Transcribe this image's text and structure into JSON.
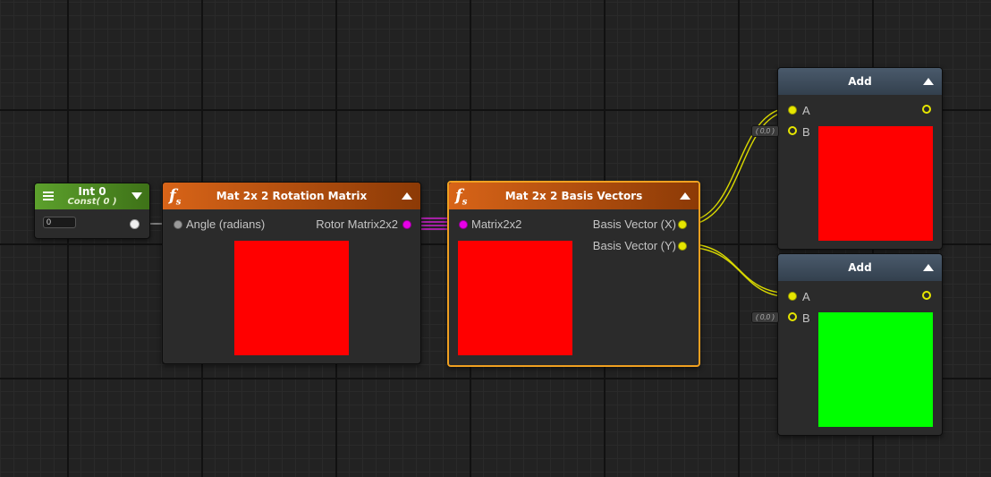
{
  "nodes": {
    "int_node": {
      "title": "Int 0",
      "subtitle": "Const( 0 )",
      "value": "0",
      "header_color": "#5ca02c"
    },
    "rotation_node": {
      "title": "Mat 2x 2 Rotation Matrix",
      "icon": "fs-function-icon",
      "input_label": "Angle (radians)",
      "output_label": "Rotor Matrix2x2",
      "preview_color": "#ff0000",
      "header_color": "#d86418"
    },
    "basis_node": {
      "title": "Mat 2x 2 Basis Vectors",
      "icon": "fs-function-icon",
      "input_label": "Matrix2x2",
      "output_x_label": "Basis Vector (X)",
      "output_y_label": "Basis Vector (Y)",
      "preview_color": "#ff0000",
      "selected": true,
      "selection_color": "#f0a020"
    },
    "add_node_1": {
      "title": "Add",
      "input_a": "A",
      "input_b": "B",
      "default_b": "( 0,0 )",
      "preview_color": "#ff0000"
    },
    "add_node_2": {
      "title": "Add",
      "input_a": "A",
      "input_b": "B",
      "default_b": "( 0,0 )",
      "preview_color": "#00ff00"
    }
  },
  "port_colors": {
    "float": "#e6e600",
    "matrix": "#e800e8",
    "int": "#efefef",
    "angle": "#9a9a9a"
  },
  "canvas": {
    "background": "#222222"
  }
}
